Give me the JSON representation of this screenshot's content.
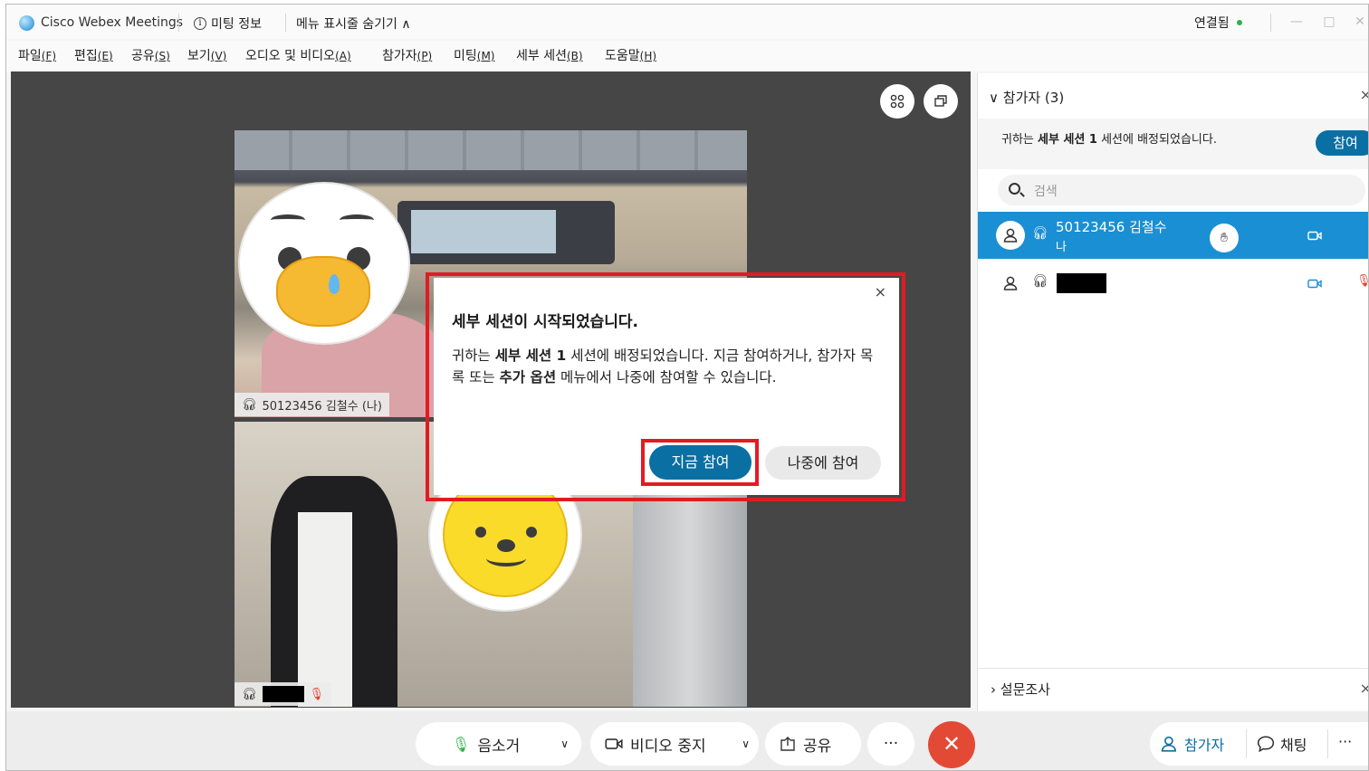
{
  "window": {
    "app_name": "Cisco Webex Meetings",
    "meeting_info": "미팅 정보",
    "hide_menu": "메뉴 표시줄 숨기기 ∧",
    "connection_status": "연결됨",
    "colors": {
      "accent": "#0a6fa3",
      "selected_row": "#1a8fd3",
      "end_call": "#e34a35",
      "highlight": "#e21b23",
      "connected": "#2fb14a"
    }
  },
  "menu": [
    {
      "label": "파일",
      "key": "(F)"
    },
    {
      "label": "편집",
      "key": "(E)"
    },
    {
      "label": "공유",
      "key": "(S)"
    },
    {
      "label": "보기",
      "key": "(V)"
    },
    {
      "label": "오디오 및 비디오",
      "key": "(A)"
    },
    {
      "label": "참가자",
      "key": "(P)"
    },
    {
      "label": "미팅",
      "key": "(M)"
    },
    {
      "label": "세부 세션",
      "key": "(B)"
    },
    {
      "label": "도움말",
      "key": "(H)"
    }
  ],
  "videos": {
    "self_label": "50123456 김철수 (나)"
  },
  "dialog": {
    "close": "×",
    "title": "세부 세션이 시작되었습니다.",
    "body_1": "귀하는 ",
    "session_name": "세부 세션 1",
    "body_2": " 세션에 배정되었습니다. 지금 참여하거나, 참가자 목록 또는 ",
    "menu_name": "추가 옵션",
    "body_3": " 메뉴에서 나중에 참여할 수 있습니다.",
    "join_now": "지금 참여",
    "join_later": "나중에 참여"
  },
  "panel": {
    "title": "참가자 (3)",
    "close": "×",
    "assign_1": "귀하는 ",
    "assign_session": "세부 세션 1",
    "assign_2": " 세션에 배정되었습니다.",
    "join_button": "참여",
    "search_placeholder": "검색",
    "participants": [
      {
        "name": "50123456 김철수",
        "sub": "나",
        "selected": true
      },
      {
        "name": "",
        "sub": "",
        "selected": false
      }
    ],
    "poll_label": "설문조사",
    "poll_close": "×"
  },
  "toolbar": {
    "mute": "음소거",
    "stop_video": "비디오 중지",
    "share": "공유",
    "more": "···",
    "participants": "참가자",
    "chat": "채팅",
    "more_right": "···"
  }
}
